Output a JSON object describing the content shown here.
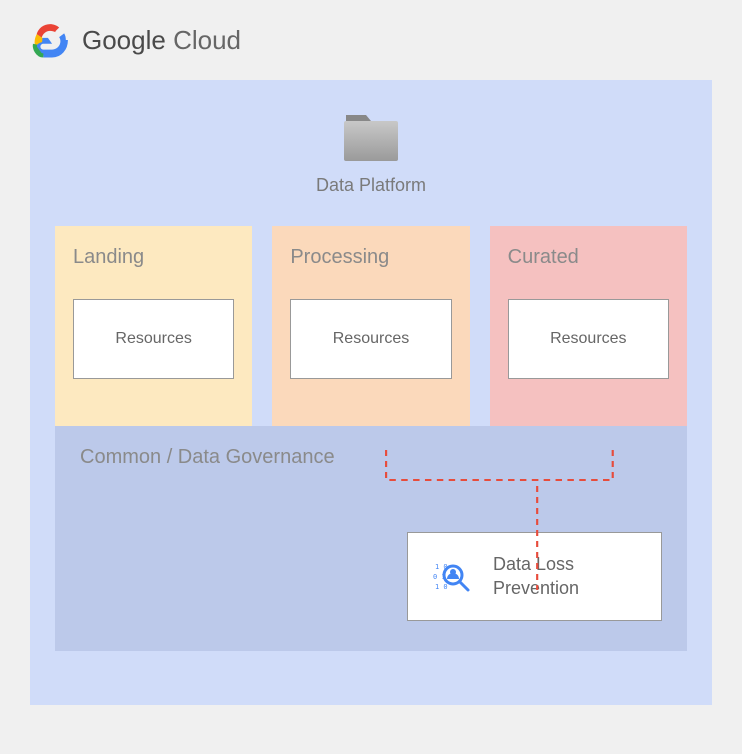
{
  "header": {
    "brand_bold": "Google",
    "brand_light": " Cloud"
  },
  "platform": {
    "label": "Data Platform"
  },
  "stages": {
    "landing": {
      "title": "Landing",
      "box": "Resources"
    },
    "processing": {
      "title": "Processing",
      "box": "Resources"
    },
    "curated": {
      "title": "Curated",
      "box": "Resources"
    }
  },
  "governance": {
    "title": "Common / Data Governance",
    "dlp": {
      "label_line1": "Data Loss",
      "label_line2": "Prevention"
    }
  },
  "colors": {
    "outer_bg": "#d0dcf9",
    "landing_bg": "#fde9c0",
    "processing_bg": "#fbd9bb",
    "curated_bg": "#f5c1c0",
    "governance_bg": "#bcc9ea",
    "connector": "#e74c3c"
  }
}
